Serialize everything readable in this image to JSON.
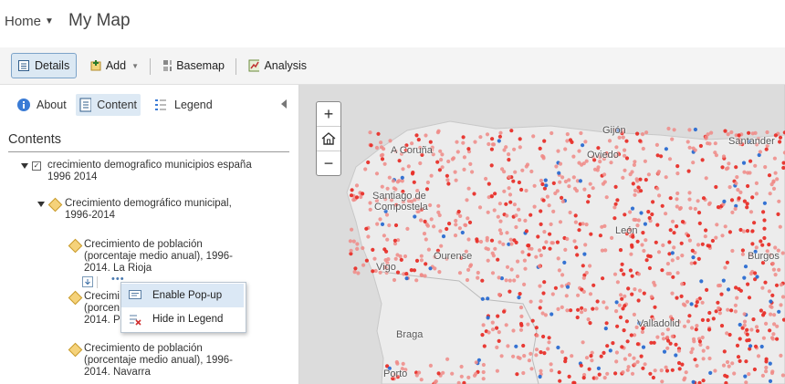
{
  "header": {
    "home_label": "Home",
    "map_title": "My Map"
  },
  "toolbar": {
    "details_label": "Details",
    "add_label": "Add",
    "basemap_label": "Basemap",
    "analysis_label": "Analysis"
  },
  "tabs": {
    "about_label": "About",
    "content_label": "Content",
    "legend_label": "Legend"
  },
  "contents_title": "Contents",
  "layers": {
    "root": {
      "line1": "crecimiento demografico municipios españa",
      "line2": "1996 2014"
    },
    "group": {
      "line1": "Crecimiento demográfico municipal,",
      "line2": "1996-2014"
    },
    "items": [
      {
        "line1": "Crecimiento de población",
        "line2": "(porcentaje medio anual), 1996-",
        "line3": "2014. La Rioja"
      },
      {
        "line1": "Crecimi",
        "line2": "(porcen",
        "line3": "2014. P"
      },
      {
        "line1": "Crecimiento de población",
        "line2": "(porcentaje medio anual), 1996-",
        "line3": "2014. Navarra"
      }
    ]
  },
  "context_menu": {
    "enable_popup": "Enable Pop-up",
    "hide_legend": "Hide in Legend"
  },
  "map": {
    "zoom_in": "+",
    "zoom_out": "−",
    "places": [
      "Gijón",
      "A Coruña",
      "Oviedo",
      "Santander",
      "Santiago de",
      "Compostela",
      "León",
      "Ourense",
      "Vigo",
      "Burgos",
      "Valladolid",
      "Braga",
      "Porto"
    ]
  },
  "colors": {
    "accent": "#7ca3c9",
    "dot_red": "#e8302a",
    "dot_pink": "#f08a86",
    "dot_blue": "#2a6bd1",
    "land": "#ececec",
    "sea": "#d4d4d4"
  }
}
